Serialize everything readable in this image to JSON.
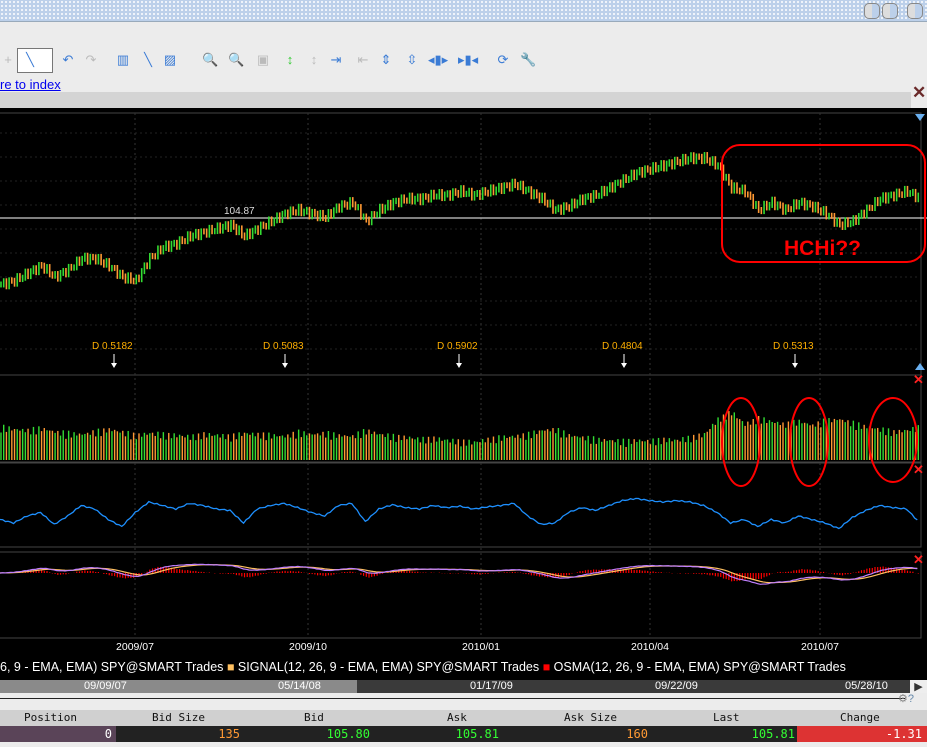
{
  "toolbar": {
    "link_text": "re to index",
    "icons": [
      "crosshair-icon",
      "line-tool-icon",
      "undo-icon",
      "redo-icon",
      "chart-type-icon",
      "trendline-icon",
      "channel-icon",
      "zoom-in-icon",
      "zoom-out-icon",
      "fit-icon",
      "expand-vertical-icon",
      "shrink-vertical-icon",
      "scroll-right-icon",
      "scroll-left-icon",
      "expand-icon",
      "compress-icon",
      "widen-icon",
      "narrow-icon",
      "refresh-icon",
      "settings-wrench-icon"
    ]
  },
  "chart_data": {
    "type": "line",
    "title": "SPY@SMART Trades",
    "x_ticks": [
      "2009/07",
      "2009/10",
      "2010/01",
      "2010/04",
      "2010/07"
    ],
    "reference_line": {
      "value": 104.87,
      "label": "104.87"
    },
    "price_weekly": [
      87,
      88,
      90,
      92,
      89,
      91,
      94,
      94,
      92,
      89,
      88,
      94,
      97,
      98,
      100,
      101,
      102,
      103,
      100,
      102,
      104,
      106,
      107,
      106,
      105,
      108,
      109,
      104,
      107,
      109,
      110,
      110,
      111,
      111,
      112,
      111,
      112,
      113,
      114,
      112,
      110,
      107,
      108,
      110,
      111,
      113,
      115,
      117,
      118,
      119,
      120,
      121,
      121,
      119,
      113,
      112,
      107,
      109,
      107,
      109,
      108,
      106,
      103,
      104,
      107,
      110,
      111,
      112,
      110
    ],
    "volume_weekly": [
      55,
      50,
      48,
      52,
      45,
      42,
      40,
      45,
      50,
      44,
      38,
      42,
      40,
      38,
      35,
      40,
      38,
      36,
      42,
      40,
      38,
      36,
      44,
      40,
      42,
      38,
      36,
      48,
      40,
      36,
      34,
      30,
      32,
      28,
      26,
      24,
      30,
      34,
      36,
      40,
      48,
      50,
      38,
      34,
      30,
      28,
      26,
      28,
      26,
      30,
      28,
      34,
      40,
      70,
      85,
      60,
      72,
      65,
      60,
      66,
      58,
      68,
      70,
      62,
      55,
      50,
      45,
      48,
      55
    ],
    "oscillator_weekly": [
      35,
      30,
      40,
      45,
      28,
      40,
      55,
      50,
      35,
      25,
      45,
      60,
      55,
      50,
      58,
      55,
      50,
      48,
      30,
      50,
      55,
      58,
      52,
      45,
      40,
      55,
      58,
      32,
      50,
      56,
      52,
      50,
      55,
      52,
      54,
      50,
      53,
      55,
      58,
      40,
      28,
      30,
      45,
      52,
      48,
      55,
      62,
      65,
      62,
      60,
      62,
      60,
      55,
      45,
      30,
      35,
      25,
      35,
      30,
      40,
      35,
      30,
      22,
      38,
      48,
      55,
      52,
      50,
      30
    ],
    "dividends": [
      "D 0.5182",
      "D 0.5083",
      "D 0.5902",
      "D 0.4804",
      "D 0.5313"
    ],
    "legend": [
      {
        "label": "6, 9 - EMA, EMA) SPY@SMART Trades",
        "color": "#ffffff"
      },
      {
        "label": "SIGNAL(12, 26, 9 - EMA, EMA) SPY@SMART Trades",
        "color": "#ffc060"
      },
      {
        "label": "OSMA(12, 26, 9 - EMA, EMA) SPY@SMART Trades",
        "color": "#ff0000"
      }
    ],
    "annotation": "HCHi??"
  },
  "colors": {
    "up": "#33dd33",
    "down": "#ff9933",
    "osc": "#1e90ff",
    "annot": "#ff0000",
    "macd": "#c080ff",
    "signal": "#ffc060"
  },
  "scroller": {
    "dates": [
      "09/09/07",
      "05/14/08",
      "01/17/09",
      "09/22/09",
      "05/28/10"
    ]
  },
  "quote": {
    "headers": [
      "Position",
      "Bid Size",
      "Bid",
      "Ask",
      "Ask Size",
      "Last",
      "Change"
    ],
    "values": [
      "0",
      "135",
      "105.80",
      "105.81",
      "160",
      "105.81",
      "-1.31"
    ]
  }
}
